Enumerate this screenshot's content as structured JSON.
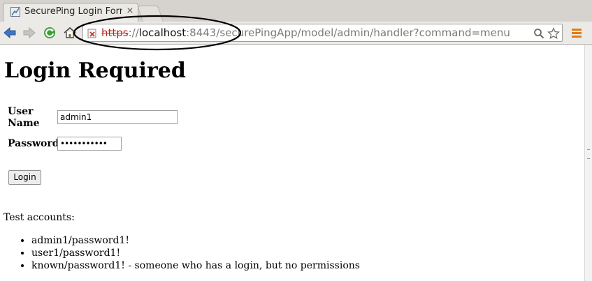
{
  "browser": {
    "tab_title": "SecurePing Login Form",
    "tab_close": "×",
    "url": {
      "scheme": "https",
      "separator": "://",
      "host": "localhost",
      "rest": ":8443/securePingApp/model/admin/handler?command=menu"
    },
    "icons": {
      "back": "back-arrow-icon",
      "forward": "forward-arrow-icon",
      "reload": "reload-icon",
      "home": "home-icon",
      "security": "insecure-lock-icon",
      "search": "search-icon",
      "bookmark": "star-icon",
      "menu": "menu-icon"
    },
    "annotation_color": "#000000",
    "security_error_color": "#b3261e"
  },
  "page": {
    "heading": "Login Required",
    "username": {
      "label_line1": "User",
      "label_line2": "Name",
      "value": "admin1"
    },
    "password": {
      "label": "Password",
      "value": "•••••••••••"
    },
    "login_button": "Login",
    "test_accounts_heading": "Test accounts:",
    "test_accounts": [
      "admin1/password1!",
      "user1/password1!",
      "known/password1! - someone who has a login, but no permissions"
    ]
  }
}
